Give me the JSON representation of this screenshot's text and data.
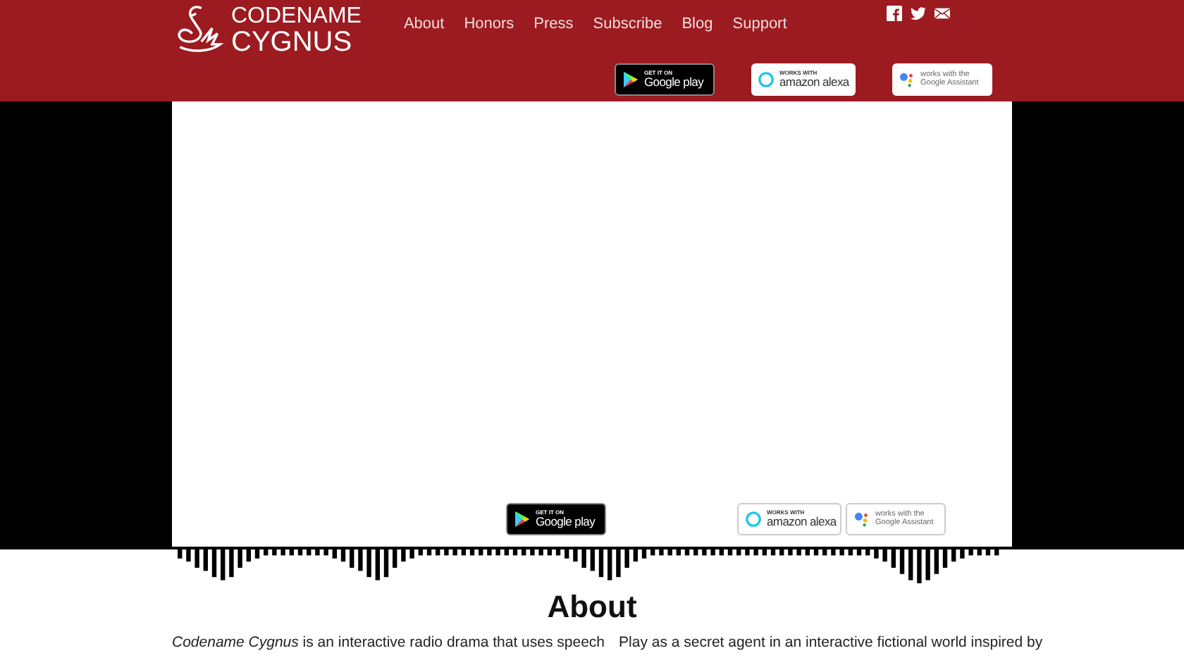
{
  "logo": {
    "line_1": "CODENAME",
    "line_2": "CYGNUS"
  },
  "nav": [
    "About",
    "Honors",
    "Press",
    "Subscribe",
    "Blog",
    "Support"
  ],
  "social": [
    {
      "kind": "facebook"
    },
    {
      "kind": "twitter"
    },
    {
      "kind": "mail"
    }
  ],
  "header_badges": [
    {
      "kind": "google_play",
      "top": "GET IT ON",
      "bottom": "Google play"
    },
    {
      "kind": "alexa",
      "top": "WORKS WITH",
      "bottom": "amazon alexa"
    },
    {
      "kind": "assistant",
      "top": "works with the",
      "bottom": "Google Assistant"
    }
  ],
  "video_badges": [
    {
      "kind": "google_play",
      "top": "GET IT ON",
      "bottom": "Google play"
    },
    {
      "kind": "alexa",
      "top": "WORKS WITH",
      "bottom": "amazon alexa"
    },
    {
      "kind": "assistant",
      "top": "works with the",
      "bottom": "Google Assistant"
    }
  ],
  "about": {
    "heading": "About",
    "columns": [
      "*Codename Cygnus* is an interactive radio drama that uses speech",
      "Play as a secret agent in an interactive fictional world inspired by"
    ]
  }
}
